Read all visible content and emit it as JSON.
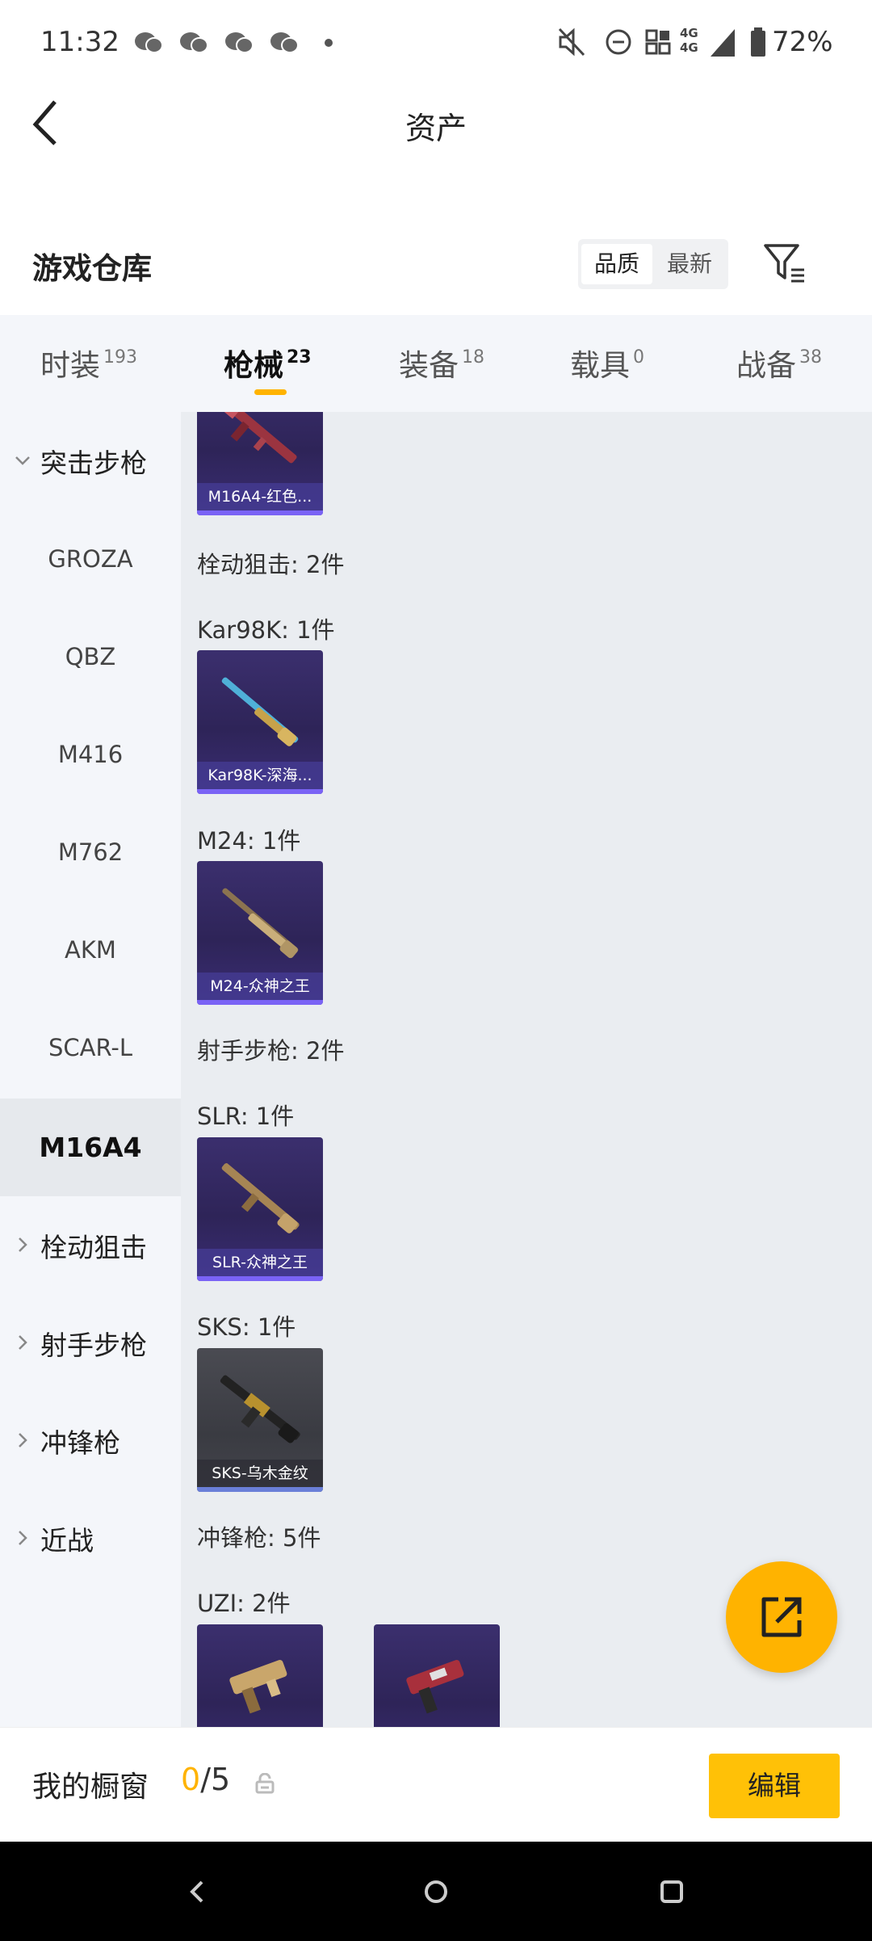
{
  "status_bar": {
    "time": "11:32",
    "battery": "72%",
    "icons": [
      "wechat-icon",
      "wechat-icon",
      "wechat-icon",
      "wechat-icon",
      "dot-icon",
      "mute-icon",
      "dnd-icon",
      "nfc-icon",
      "signal-icon",
      "battery-icon"
    ],
    "network_label_top": "4G",
    "network_label_bottom": "4G"
  },
  "header": {
    "title": "资产",
    "back_icon": "chevron-left-icon"
  },
  "warehouse": {
    "title": "游戏仓库",
    "sort_options": [
      {
        "label": "品质",
        "active": true
      },
      {
        "label": "最新",
        "active": false
      }
    ],
    "filter_icon": "filter-icon"
  },
  "tabs": [
    {
      "label": "时装",
      "count": "193",
      "active": false
    },
    {
      "label": "枪械",
      "count": "23",
      "active": true
    },
    {
      "label": "装备",
      "count": "18",
      "active": false
    },
    {
      "label": "载具",
      "count": "0",
      "active": false
    },
    {
      "label": "战备",
      "count": "38",
      "active": false
    }
  ],
  "sidebar": {
    "items": [
      {
        "label": "突击步枪",
        "type": "category",
        "expanded": true
      },
      {
        "label": "GROZA",
        "type": "sub"
      },
      {
        "label": "QBZ",
        "type": "sub"
      },
      {
        "label": "M416",
        "type": "sub"
      },
      {
        "label": "M762",
        "type": "sub"
      },
      {
        "label": "AKM",
        "type": "sub"
      },
      {
        "label": "SCAR-L",
        "type": "sub"
      },
      {
        "label": "M16A4",
        "type": "sub",
        "active": true
      },
      {
        "label": "栓动狙击",
        "type": "category",
        "expanded": false
      },
      {
        "label": "射手步枪",
        "type": "category",
        "expanded": false
      },
      {
        "label": "冲锋枪",
        "type": "category",
        "expanded": false
      },
      {
        "label": "近战",
        "type": "category",
        "expanded": false
      }
    ]
  },
  "content": {
    "cards": [
      {
        "caption": "M16A4-红色...",
        "style": "purple"
      },
      {
        "caption": "Kar98K-深海...",
        "style": "purple"
      },
      {
        "caption": "M24-众神之王",
        "style": "purple"
      },
      {
        "caption": "SLR-众神之王",
        "style": "purple"
      },
      {
        "caption": "SKS-乌木金纹",
        "style": "gray"
      },
      {
        "caption": "",
        "style": "purple"
      },
      {
        "caption": "",
        "style": "purple"
      }
    ],
    "groups": [
      {
        "label": "栓动狙击: 2件"
      },
      {
        "label": "射手步枪: 2件"
      },
      {
        "label": "冲锋枪: 5件"
      }
    ],
    "subgroups": [
      {
        "label": "Kar98K: 1件"
      },
      {
        "label": "M24: 1件"
      },
      {
        "label": "SLR: 1件"
      },
      {
        "label": "SKS: 1件"
      },
      {
        "label": "UZI: 2件"
      }
    ]
  },
  "fab": {
    "icon": "share-external-icon"
  },
  "showcase": {
    "label": "我的橱窗",
    "current": "0",
    "separator_total": "/5",
    "lock_icon": "lock-icon",
    "edit_label": "编辑"
  },
  "navbar": {
    "icons": [
      "nav-back-icon",
      "nav-home-icon",
      "nav-recents-icon"
    ]
  },
  "colors": {
    "accent": "#ffb300",
    "edit_button": "#ffc107",
    "card_purple": "#2e2458",
    "card_gray": "#3a3b42",
    "card_bar": "#7a63f5",
    "panel_bg": "#eaedf1",
    "sidebar_bg": "#f4f6fa"
  }
}
